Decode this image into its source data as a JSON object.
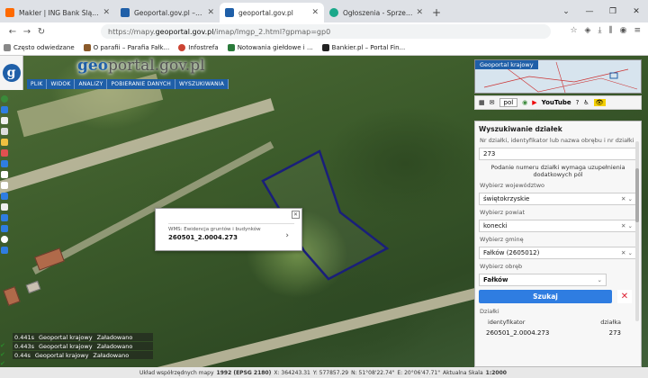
{
  "browser": {
    "tabs": [
      {
        "title": "Makler | ING Bank Śląski",
        "color": "#ff6a00",
        "active": false
      },
      {
        "title": "Geoportal.gov.pl – Geoportal Infr...",
        "color": "#1f5fa8",
        "active": false
      },
      {
        "title": "geoportal.gov.pl",
        "color": "#1f5fa8",
        "active": true
      },
      {
        "title": "Ogłoszenia - Sprzedam, kupię on...",
        "color": "#1aa88a",
        "active": false
      }
    ],
    "new_tab": "+",
    "url_prefix": "https://mapy.",
    "url_host": "geoportal.gov.pl",
    "url_path": "/imap/Imgp_2.html?gpmap=gp0",
    "bookmarks": [
      {
        "label": "Często odwiedzane",
        "color": "#888888"
      },
      {
        "label": "O parafii – Parafia Fałk...",
        "color": "#8a5a2a"
      },
      {
        "label": "Infostrefa",
        "color": "#c43"
      },
      {
        "label": "Notowania giełdowe i ...",
        "color": "#2a7a3a"
      },
      {
        "label": "Bankier.pl – Portal Fin...",
        "color": "#222222"
      }
    ]
  },
  "app": {
    "logo_letter": "g",
    "brand_prefix": "geo",
    "brand_suffix": "portal.gov.pl",
    "menu": [
      "PLIK",
      "WIDOK",
      "ANALIZY",
      "POBIERANIE DANYCH",
      "WYSZUKIWANIA"
    ]
  },
  "overview": {
    "title": "Geoportal krajowy"
  },
  "toolbar_icons": {
    "lang": "pol",
    "youtube": "YouTube"
  },
  "search_panel": {
    "title": "Wyszukiwanie działek",
    "id_label": "Nr działki, identyfikator lub nazwa obrębu i nr działki",
    "id_value": "273",
    "note": "Podanie numeru działki wymaga uzupełnienia dodatkowych pól",
    "voivodeship_label": "Wybierz województwo",
    "voivodeship_value": "świętokrzyskie",
    "county_label": "Wybierz powiat",
    "county_value": "konecki",
    "commune_label": "Wybierz gminę",
    "commune_value": "Fałków (2605012)",
    "precinct_label": "Wybierz obręb",
    "precinct_value": "Fałków",
    "search_button": "Szukaj",
    "clear_button": "✕",
    "results_label": "Działki",
    "results_columns": [
      "identyfikator",
      "działka"
    ],
    "results_rows": [
      {
        "id": "260501_2.0004.273",
        "parcel": "273"
      }
    ]
  },
  "popup": {
    "title": "WMS: Ewidencja gruntów i budynków",
    "value": "260501_2.0004.273"
  },
  "load_rows": [
    {
      "time": "0.441s",
      "service": "Geoportal krajowy",
      "status": "Załadowano"
    },
    {
      "time": "0.443s",
      "service": "Geoportal krajowy",
      "status": "Załadowano"
    },
    {
      "time": "0.44s",
      "service": "Geoportal krajowy",
      "status": "Załadowano"
    }
  ],
  "statusbar": {
    "prefix": "Układ współrzędnych mapy",
    "crs": "1992 (EPSG 2180)",
    "x": "X: 364243.31",
    "y": "Y: 577857.29",
    "lat": "N: 51°08'22.74\"",
    "lon": "E: 20°06'47.71\"",
    "scale_label": "Aktualna Skala",
    "scale_value": "1:2000"
  },
  "colors": {
    "accent": "#1f5fa8",
    "parcel_outline": "#1a1f7a",
    "search_button": "#2f7de1"
  }
}
